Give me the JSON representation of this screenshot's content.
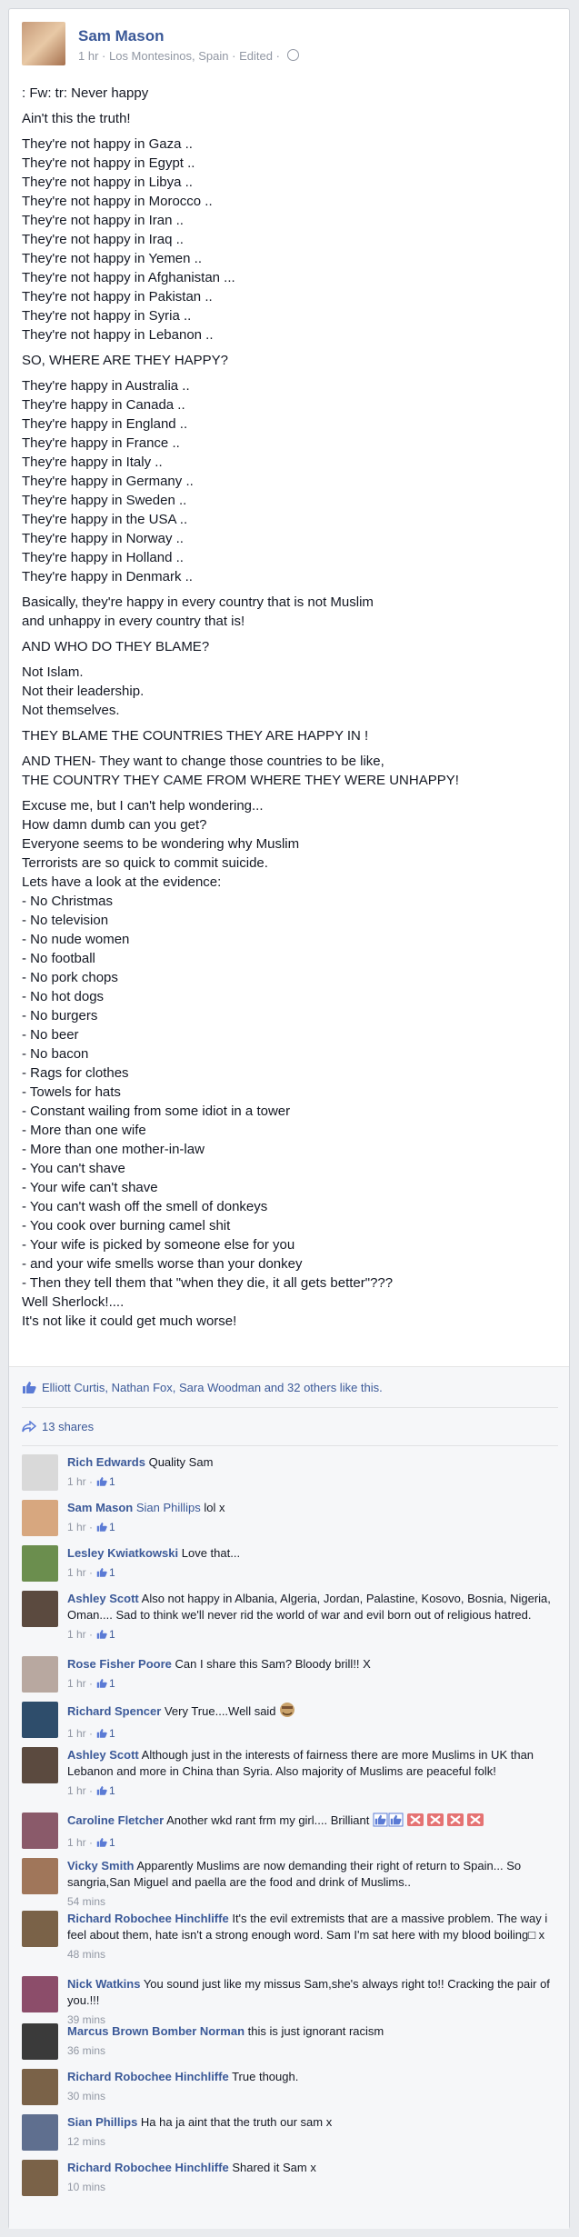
{
  "author": {
    "name": "Sam Mason",
    "time": "1 hr",
    "location": "Los Montesinos, Spain",
    "edited": "Edited"
  },
  "post_paragraphs": [
    ": Fw: tr: Never happy",
    "Ain't this the truth!",
    "They're not happy in Gaza ..\nThey're not happy in Egypt ..\nThey're not happy in Libya ..\nThey're not happy in Morocco ..\nThey're not happy in Iran ..\nThey're not happy in Iraq ..\nThey're not happy in Yemen ..\nThey're not happy in Afghanistan ...\nThey're not happy in Pakistan ..\nThey're not happy in Syria ..\nThey're not happy in Lebanon ..",
    "SO, WHERE ARE THEY HAPPY?",
    "They're happy in Australia ..\nThey're happy in Canada ..\nThey're happy in England ..\nThey're happy in France ..\nThey're happy in Italy ..\nThey're happy in Germany ..\nThey're happy in Sweden ..\nThey're happy in the USA ..\nThey're happy in Norway ..\nThey're happy in Holland ..\nThey're happy in Denmark ..",
    "Basically, they're happy in every country that is not Muslim\nand unhappy in every country that is!",
    "AND WHO DO THEY BLAME?",
    "Not Islam.\nNot their leadership.\nNot themselves.",
    "THEY BLAME THE COUNTRIES THEY ARE HAPPY IN !",
    "AND THEN- They want to change those countries to be like,\nTHE COUNTRY THEY CAME FROM WHERE THEY WERE UNHAPPY!",
    "Excuse me, but I can't help wondering...\nHow damn dumb can you get?\nEveryone seems to be wondering why Muslim\nTerrorists are so quick to commit suicide.\nLets have a look at the evidence:\n- No Christmas\n- No television\n- No nude women\n- No football\n- No pork chops\n- No hot dogs\n- No burgers\n- No beer\n- No bacon\n- Rags for clothes\n- Towels for hats\n- Constant wailing from some idiot in a tower\n- More than one wife\n- More than one mother-in-law\n- You can't shave\n- Your wife can't shave\n- You can't wash off the smell of donkeys\n- You cook over burning camel shit\n- Your wife is picked by someone else for you\n- and your wife smells worse than your donkey\n- Then they tell them that \"when they die, it all gets better\"???\nWell Sherlock!....\nIt's not like it could get much worse!"
  ],
  "likes_text": "Elliott Curtis, Nathan Fox, Sara Woodman and 32 others like this.",
  "shares_text": "13 shares",
  "comments": [
    {
      "name": "Rich Edwards",
      "text": "Quality Sam",
      "time": "1 hr",
      "likes": "1",
      "color": "#d9d9d9"
    },
    {
      "name": "Sam Mason",
      "mention": "Sian Phillips",
      "text": "lol x",
      "time": "1 hr",
      "likes": "1",
      "color": "#d7a77f"
    },
    {
      "name": "Lesley Kwiatkowski",
      "text": "Love that...",
      "time": "1 hr",
      "likes": "1",
      "color": "#6b8e4e"
    },
    {
      "name": "Ashley Scott",
      "text": "Also not happy in Albania, Algeria, Jordan, Palastine, Kosovo, Bosnia, Nigeria, Oman.... Sad to think we'll never rid the world of war and evil born out of religious hatred.",
      "time": "1 hr",
      "likes": "1",
      "color": "#5b4a3f"
    },
    {
      "name": "Rose Fisher Poore",
      "text": "Can I share this Sam? Bloody brill!! X",
      "time": "1 hr",
      "likes": "1",
      "color": "#b8a8a0"
    },
    {
      "name": "Richard Spencer",
      "text": "Very True....Well said",
      "time": "1 hr",
      "likes": "1",
      "color": "#2e4d6b",
      "emoji": "face"
    },
    {
      "name": "Ashley Scott",
      "text": "Although just in the interests of fairness there are more Muslims in UK than Lebanon and more in China than Syria. Also majority of Muslims are peaceful folk!",
      "time": "1 hr",
      "likes": "1",
      "color": "#5b4a3f"
    },
    {
      "name": "Caroline Fletcher",
      "text": "Another wkd rant frm my girl.... Brilliant",
      "time": "1 hr",
      "likes": "1",
      "color": "#8a5a6a",
      "emoji": "thumbs-x"
    },
    {
      "name": "Vicky Smith",
      "text": "Apparently Muslims are now demanding their right of return to Spain... So sangria,San Miguel and paella are the food and drink of Muslims..",
      "time": "54 mins",
      "color": "#a0765a"
    },
    {
      "name": "Richard Robochee Hinchliffe",
      "text": "It's the evil extremists that are a massive problem. The way i feel about them, hate isn't a strong enough word. Sam I'm sat here with my blood boiling□ x",
      "time": "48 mins",
      "color": "#7a6248"
    },
    {
      "name": "Nick Watkins",
      "text": "You sound just like my missus Sam,she's always right to!! Cracking the pair of you.!!!",
      "time": "39 mins",
      "color": "#8c4d6a"
    },
    {
      "name": "Marcus Brown Bomber Norman",
      "text": "this is just ignorant racism",
      "time": "36 mins",
      "color": "#3a3a3a"
    },
    {
      "name": "Richard Robochee Hinchliffe",
      "text": "True though.",
      "time": "30 mins",
      "color": "#7a6248"
    },
    {
      "name": "Sian Phillips",
      "text": "Ha ha ja aint that the truth our sam x",
      "time": "12 mins",
      "color": "#5f6f8f"
    },
    {
      "name": "Richard Robochee Hinchliffe",
      "text": "Shared it Sam x",
      "time": "10 mins",
      "color": "#7a6248"
    }
  ],
  "colors": {
    "link": "#3b5998",
    "meta": "#9197a3",
    "bg": "#e9ebee"
  }
}
